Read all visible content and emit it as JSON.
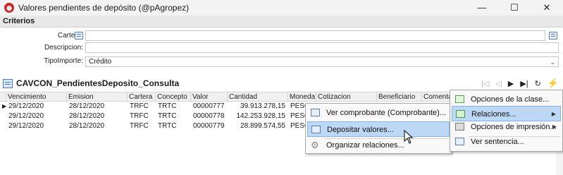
{
  "window": {
    "title": "Valores pendientes de depósito (@pAgropez)",
    "app_icon": "app-logo-icon",
    "minimize": "—",
    "maximize": "☐",
    "close": "✕"
  },
  "criteria": {
    "header": "Criterios",
    "cartera_label": "Cartera:",
    "cartera_value": "",
    "descripcion_label": "Descripcion:",
    "descripcion_value": "",
    "tipoimporte_label": "TipoImporte:",
    "tipoimporte_value": "Crédito"
  },
  "query": {
    "title": "CAVCON_PendientesDeposito_Consulta",
    "nav": {
      "first": "|◁",
      "prev": "◁",
      "next": "▶",
      "last": "▶|",
      "refresh": "↻",
      "actions": "⚡"
    }
  },
  "table": {
    "columns": [
      "Vencimiento",
      "Emision",
      "Cartera",
      "Concepto",
      "Valor",
      "Cantidad",
      "Moneda",
      "Cotizacion",
      "Beneficiario",
      "Comenta"
    ],
    "rows": [
      [
        "29/12/2020",
        "28/12/2020",
        "TRFC",
        "TRTC",
        "00000777",
        "39.913.278,15",
        "PESO"
      ],
      [
        "29/12/2020",
        "28/12/2020",
        "TRFC",
        "TRTC",
        "00000778",
        "142.253.928,15",
        "PESO"
      ],
      [
        "29/12/2020",
        "28/12/2020",
        "TRFC",
        "TRTC",
        "00000779",
        "28.899.574,55",
        "PESO"
      ]
    ],
    "current_row_marker": "▶"
  },
  "context_menu": {
    "items": [
      {
        "label": "Ver comprobante (Comprobante)...",
        "icon": "document-icon"
      },
      {
        "label": "Depositar valores...",
        "icon": "deposit-icon"
      },
      {
        "label": "Organizar relaciones...",
        "icon": "gear-icon"
      }
    ]
  },
  "actions_menu": {
    "items": [
      {
        "label": "Opciones de la clase...",
        "icon": "class-options-icon"
      },
      {
        "label": "Relaciones...",
        "icon": "relations-icon",
        "submenu_arrow": "▶"
      },
      {
        "label": "Opciones de impresión...",
        "icon": "printer-icon",
        "submenu_arrow": "▶"
      },
      {
        "label": "Ver sentencia...",
        "icon": "sentence-icon"
      }
    ]
  },
  "colors": {
    "highlight": "#bcd8f5",
    "header_bg": "#e8e8e8",
    "accent": "#4a78b8"
  }
}
